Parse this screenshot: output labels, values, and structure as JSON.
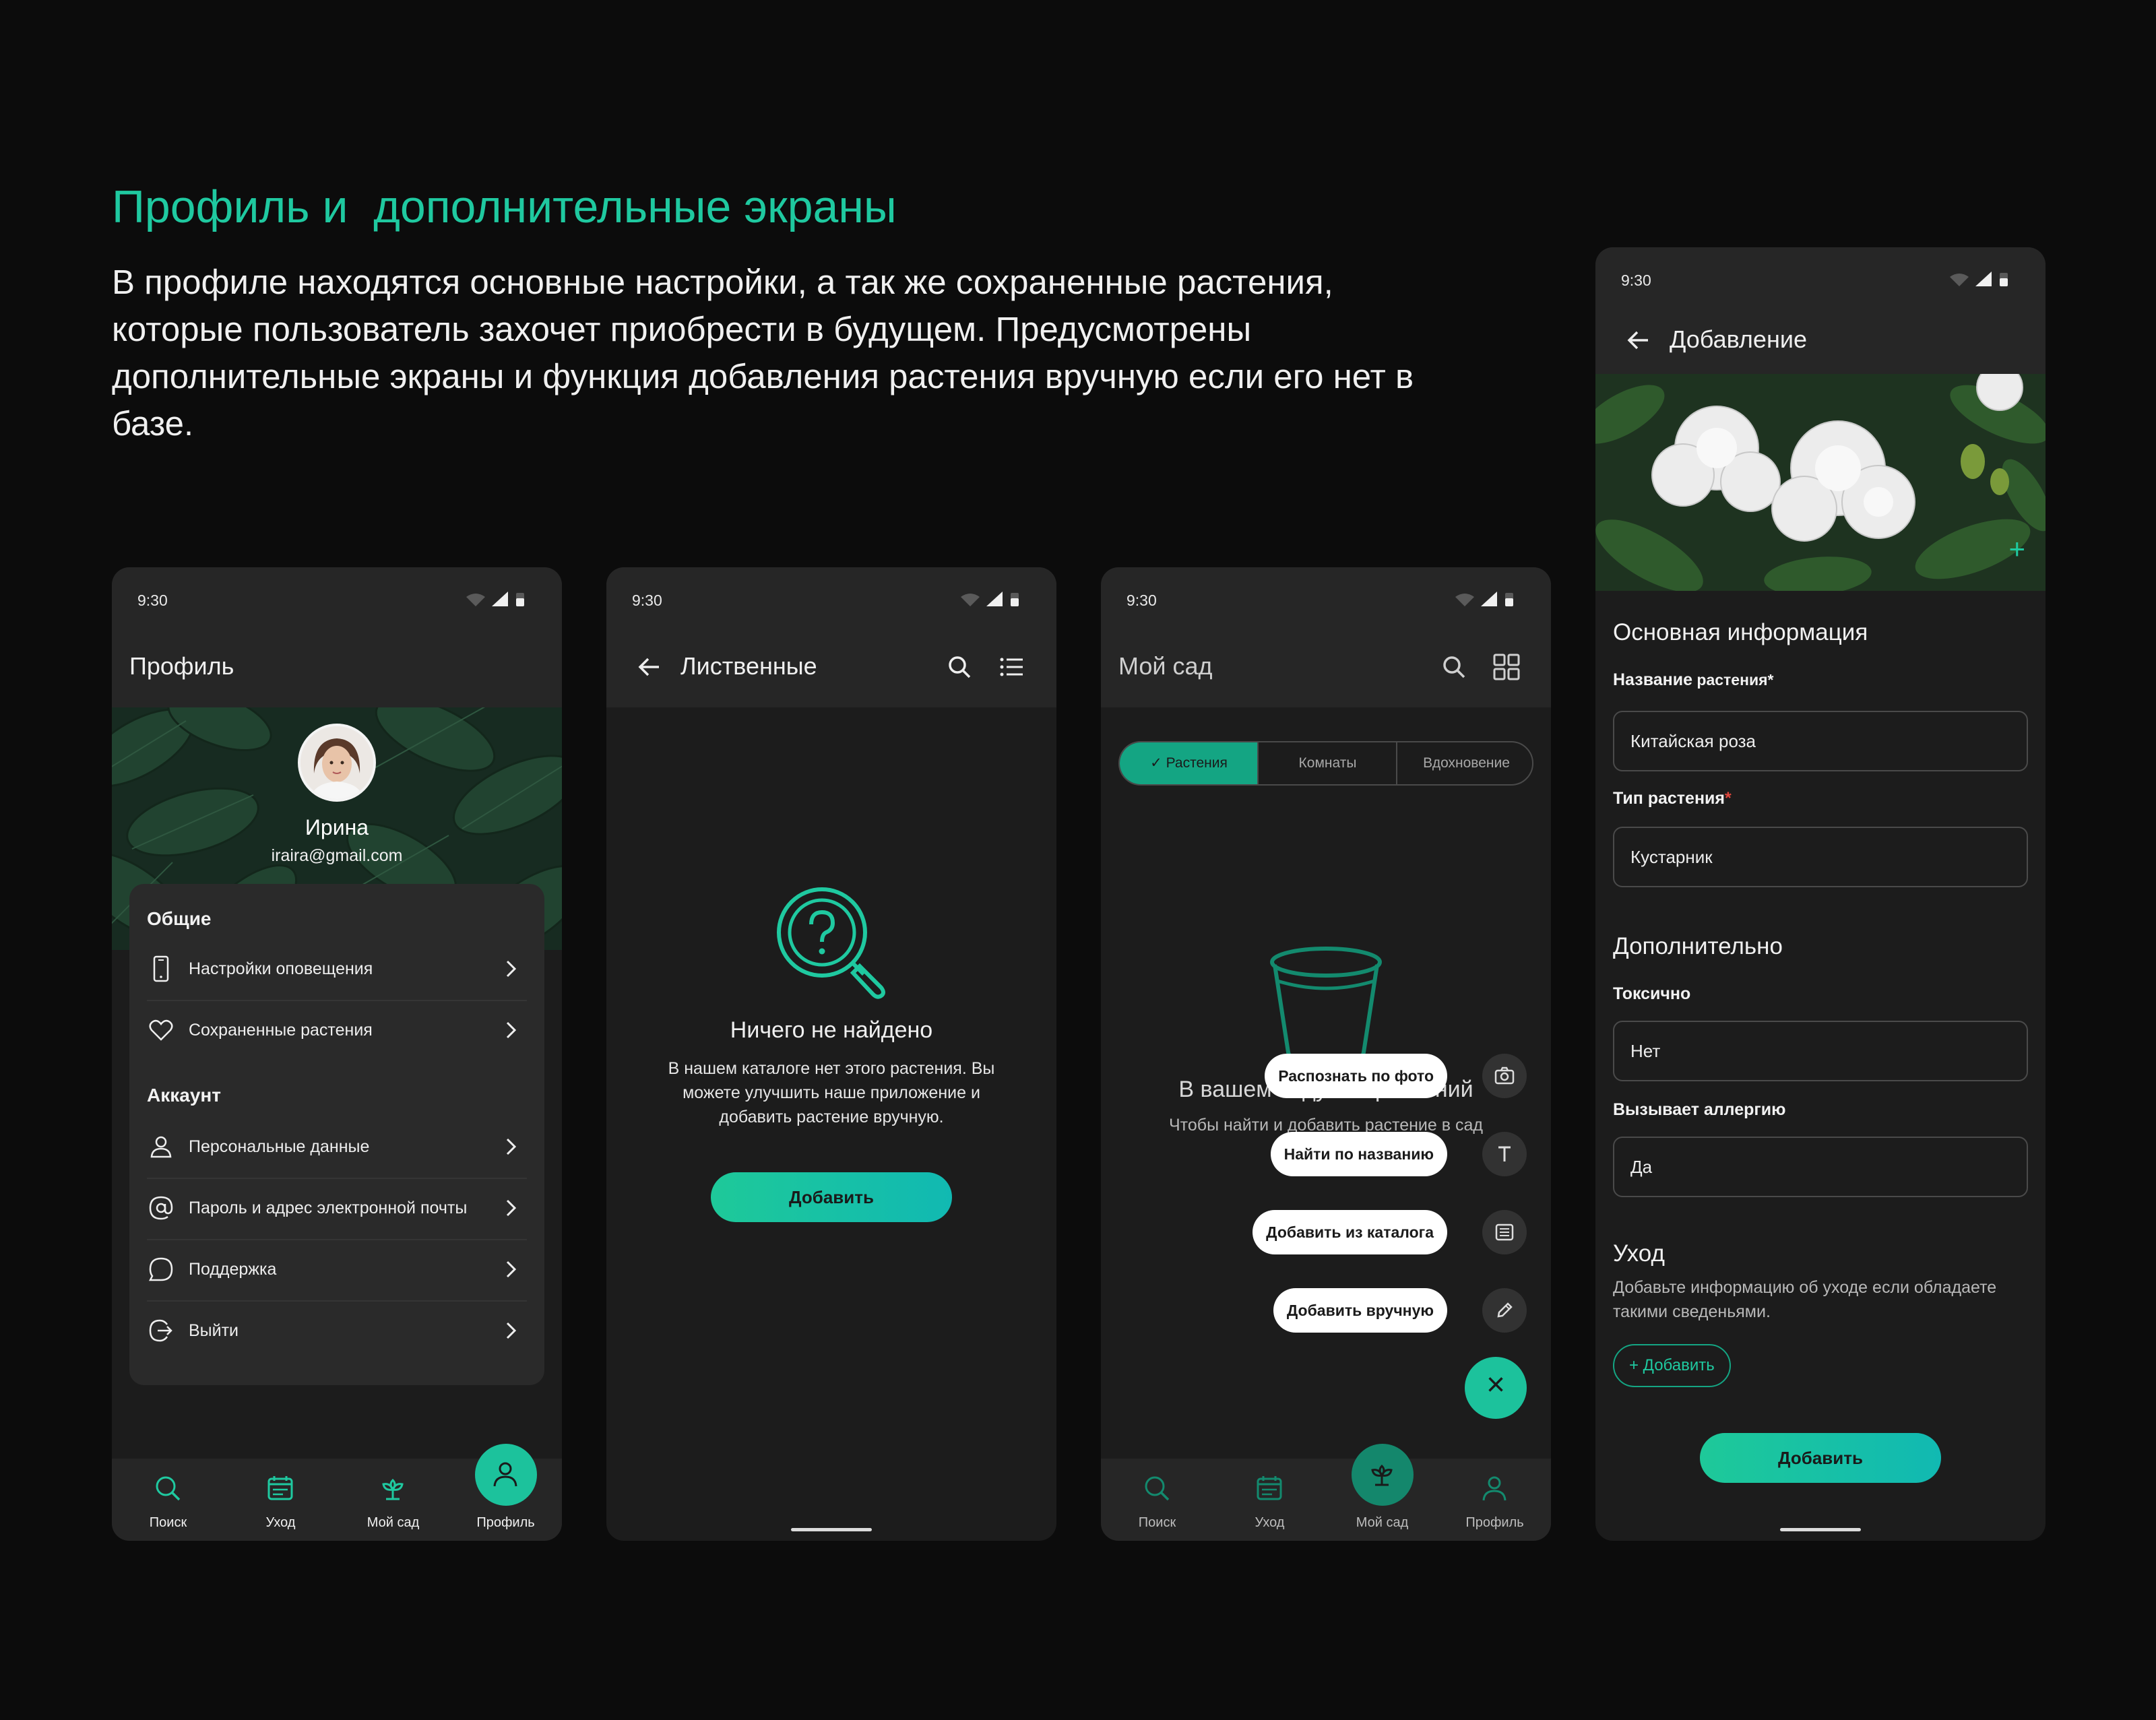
{
  "hero": {
    "title": "Профиль и  дополнительные экраны",
    "description": "В профиле находятся основные настройки, а так же сохраненные растения, которые пользователь захочет приобрести в будущем. Предусмотрены дополнительные экраны и функция добавления растения вручную если его нет в базе."
  },
  "status": {
    "time": "9:30"
  },
  "colors": {
    "accent": "#1cc29c",
    "background": "#0c0c0c",
    "surface": "#1c1c1c",
    "card": "#2a2a2a",
    "required": "#e0463c"
  },
  "nav": {
    "search": "Поиск",
    "care": "Уход",
    "garden": "Мой сад",
    "profile": "Профиль"
  },
  "profile": {
    "title": "Профиль",
    "name": "Ирина",
    "email": "iraira@gmail.com",
    "sections": [
      {
        "title": "Общие",
        "items": [
          {
            "label": "Настройки оповещения",
            "icon": "phone-icon"
          },
          {
            "label": "Сохраненные растения",
            "icon": "heart-icon"
          }
        ]
      },
      {
        "title": "Аккаунт",
        "items": [
          {
            "label": "Персональные данные",
            "icon": "user-icon"
          },
          {
            "label": "Пароль и адрес электронной почты",
            "icon": "at-icon"
          },
          {
            "label": "Поддержка",
            "icon": "chat-bubble-icon"
          },
          {
            "label": "Выйти",
            "icon": "logout-icon"
          }
        ]
      }
    ]
  },
  "search": {
    "title": "Лиственные",
    "empty_title": "Ничего не найдено",
    "empty_text": "В нашем каталоге нет этого растения. Вы можете улучшить наше приложение и добавить растение вручную.",
    "add_button": "Добавить"
  },
  "garden": {
    "title": "Мой сад",
    "tabs": [
      "✓ Растения",
      "Комнаты",
      "Вдохновение"
    ],
    "empty_title": "В вашем саду нет растений",
    "empty_text": "Чтобы найти и добавить растение в сад нажмите",
    "fab_actions": [
      {
        "label": "Распознать по фото",
        "icon": "camera-icon"
      },
      {
        "label": "Найти по названию",
        "icon": "text-icon"
      },
      {
        "label": "Добавить из каталога",
        "icon": "catalog-icon"
      },
      {
        "label": "Добавить вручную",
        "icon": "pencil-icon"
      }
    ],
    "fab_close": "×"
  },
  "add": {
    "title": "Добавление",
    "photo_add": "+",
    "basic_heading": "Основная информация",
    "name_label_bold": "Название",
    "name_label_rest": " растения*",
    "name_value": "Китайская роза",
    "type_label": "Тип растения",
    "type_required": "*",
    "type_value": "Кустарник",
    "extra_heading": "Дополнительно",
    "toxic_label": "Токсично",
    "toxic_value": "Нет",
    "allergy_label": "Вызывает аллергию",
    "allergy_value": "Да",
    "care_heading": "Уход",
    "care_text": "Добавьте информацию об уходе если обладаете такими сведеньями.",
    "care_add": "+ Добавить",
    "submit": "Добавить"
  }
}
